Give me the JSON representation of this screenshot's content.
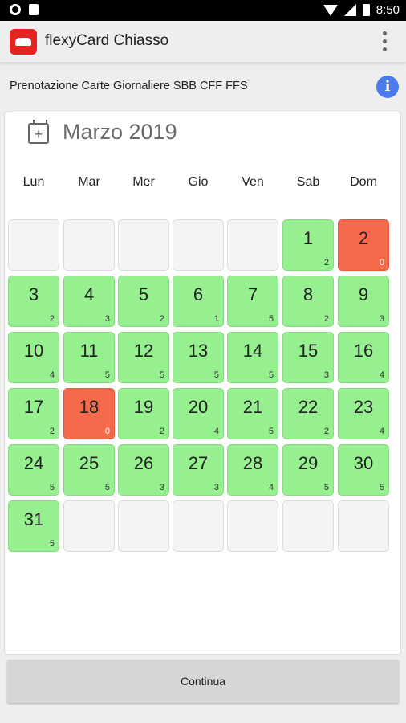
{
  "status_bar": {
    "time": "8:50"
  },
  "app_bar": {
    "title": "flexyCard Chiasso"
  },
  "subtitle": "Prenotazione Carte Giornaliere SBB CFF FFS",
  "calendar": {
    "month_label": "Marzo 2019",
    "weekdays": [
      "Lun",
      "Mar",
      "Mer",
      "Gio",
      "Ven",
      "Sab",
      "Dom"
    ],
    "leading_empty": 5,
    "trailing_empty": 6,
    "days": [
      {
        "day": "1",
        "count": "2",
        "status": "available"
      },
      {
        "day": "2",
        "count": "0",
        "status": "full"
      },
      {
        "day": "3",
        "count": "2",
        "status": "available"
      },
      {
        "day": "4",
        "count": "3",
        "status": "available"
      },
      {
        "day": "5",
        "count": "2",
        "status": "available"
      },
      {
        "day": "6",
        "count": "1",
        "status": "available"
      },
      {
        "day": "7",
        "count": "5",
        "status": "available"
      },
      {
        "day": "8",
        "count": "2",
        "status": "available"
      },
      {
        "day": "9",
        "count": "3",
        "status": "available"
      },
      {
        "day": "10",
        "count": "4",
        "status": "available"
      },
      {
        "day": "11",
        "count": "5",
        "status": "available"
      },
      {
        "day": "12",
        "count": "5",
        "status": "available"
      },
      {
        "day": "13",
        "count": "5",
        "status": "available"
      },
      {
        "day": "14",
        "count": "5",
        "status": "available"
      },
      {
        "day": "15",
        "count": "3",
        "status": "available"
      },
      {
        "day": "16",
        "count": "4",
        "status": "available"
      },
      {
        "day": "17",
        "count": "2",
        "status": "available"
      },
      {
        "day": "18",
        "count": "0",
        "status": "full"
      },
      {
        "day": "19",
        "count": "2",
        "status": "available"
      },
      {
        "day": "20",
        "count": "4",
        "status": "available"
      },
      {
        "day": "21",
        "count": "5",
        "status": "available"
      },
      {
        "day": "22",
        "count": "2",
        "status": "available"
      },
      {
        "day": "23",
        "count": "4",
        "status": "available"
      },
      {
        "day": "24",
        "count": "5",
        "status": "available"
      },
      {
        "day": "25",
        "count": "5",
        "status": "available"
      },
      {
        "day": "26",
        "count": "3",
        "status": "available"
      },
      {
        "day": "27",
        "count": "3",
        "status": "available"
      },
      {
        "day": "28",
        "count": "4",
        "status": "available"
      },
      {
        "day": "29",
        "count": "5",
        "status": "available"
      },
      {
        "day": "30",
        "count": "5",
        "status": "available"
      },
      {
        "day": "31",
        "count": "5",
        "status": "available"
      }
    ]
  },
  "continue_label": "Continua",
  "colors": {
    "available": "#96f08f",
    "full": "#f66a4c",
    "info_icon": "#4a7cf0",
    "app_logo": "#e52421"
  },
  "icons": [
    "calendar-add-icon",
    "info-icon",
    "overflow-menu-icon",
    "wifi-icon",
    "signal-icon",
    "battery-icon"
  ]
}
